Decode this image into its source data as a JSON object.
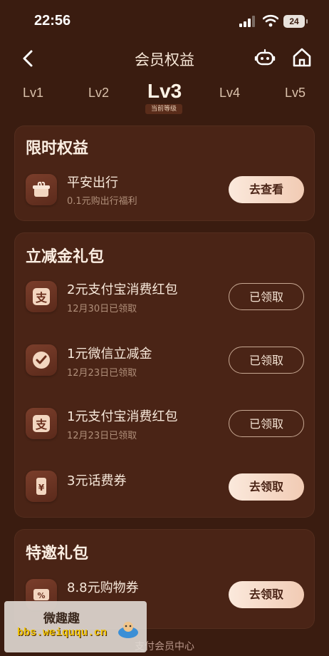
{
  "status": {
    "time": "22:56",
    "battery": "24"
  },
  "nav": {
    "title": "会员权益"
  },
  "levels": {
    "items": [
      "Lv1",
      "Lv2",
      "Lv3",
      "Lv4",
      "Lv5"
    ],
    "current_tag": "当前等级"
  },
  "section1": {
    "title": "限时权益",
    "items": [
      {
        "title": "平安出行",
        "subtitle": "0.1元购出行福利",
        "button": "去查看",
        "icon": "gift-pot-icon"
      }
    ]
  },
  "section2": {
    "title": "立减金礼包",
    "items": [
      {
        "title": "2元支付宝消费红包",
        "subtitle": "12月30日已领取",
        "button": "已领取",
        "icon": "alipay-icon"
      },
      {
        "title": "1元微信立减金",
        "subtitle": "12月23日已领取",
        "button": "已领取",
        "icon": "wechat-pay-icon"
      },
      {
        "title": "1元支付宝消费红包",
        "subtitle": "12月23日已领取",
        "button": "已领取",
        "icon": "alipay-icon"
      },
      {
        "title": "3元话费券",
        "subtitle": "",
        "button": "去领取",
        "icon": "phone-bill-icon"
      }
    ]
  },
  "section3": {
    "title": "特邀礼包",
    "items": [
      {
        "title": "8.8元购物券",
        "subtitle": "",
        "button": "去领取",
        "icon": "coupon-icon"
      }
    ]
  },
  "watermark": {
    "line1": "微趣趣",
    "line2": "bbs.weiququ.cn"
  },
  "footer": {
    "text": "支付会员中心"
  },
  "colors": {
    "background": "#3a1c10",
    "card": "#4a2416",
    "accent": "#f1cbb4"
  }
}
